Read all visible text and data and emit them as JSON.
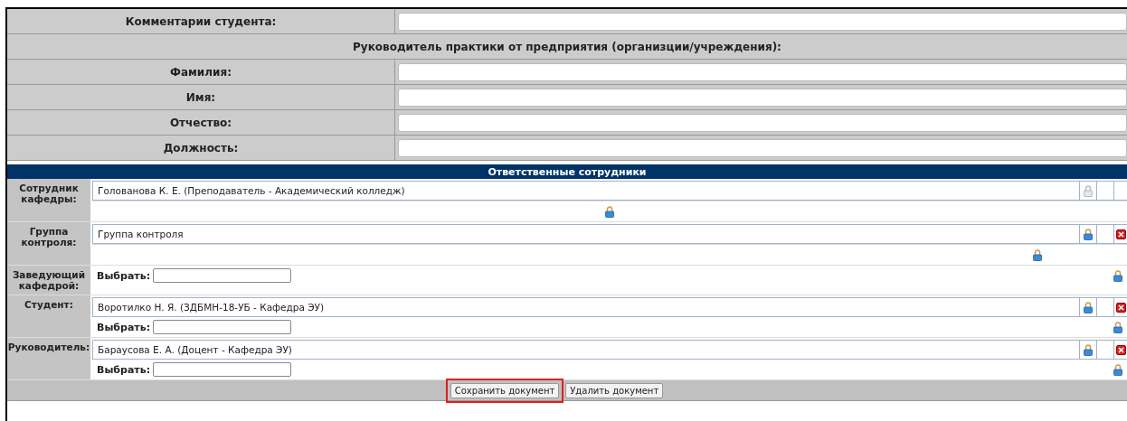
{
  "form_rows": [
    {
      "kind": "field",
      "label": "Комментарии студента:",
      "value": ""
    },
    {
      "kind": "section",
      "label": "Руководитель практики от предприятия (организции/учреждения):"
    },
    {
      "kind": "field",
      "label": "Фамилия:",
      "value": ""
    },
    {
      "kind": "field",
      "label": "Имя:",
      "value": ""
    },
    {
      "kind": "field",
      "label": "Отчество:",
      "value": ""
    },
    {
      "kind": "field",
      "label": "Должность:",
      "value": ""
    }
  ],
  "staff_section": {
    "title": "Ответственные сотрудники",
    "rows": [
      {
        "label": "Сотрудник кафедры:",
        "name": "Голованова К. Е. (Преподаватель - Академический колледж)",
        "lock_disabled": true,
        "deletable": false,
        "extra": {
          "kind": "lock_center"
        }
      },
      {
        "label": "Группа контроля:",
        "name": "Группа контроля",
        "lock_disabled": false,
        "deletable": true,
        "extra": {
          "kind": "lock_offset"
        }
      },
      {
        "label": "Заведующий кафедрой:",
        "extra": {
          "kind": "select",
          "select_label": "Выбрать:"
        }
      },
      {
        "label": "Студент:",
        "name": "Воротилко Н. Я. (ЗДБМН-18-УБ - Кафедра ЭУ)",
        "lock_disabled": false,
        "deletable": true,
        "extra": {
          "kind": "select",
          "select_label": "Выбрать:"
        }
      },
      {
        "label": "Руководитель:",
        "name": "Бараусова Е. А. (Доцент - Кафедра ЭУ)",
        "lock_disabled": false,
        "deletable": true,
        "extra": {
          "kind": "select",
          "select_label": "Выбрать:"
        }
      }
    ]
  },
  "buttons": [
    {
      "label": "Сохранить документ",
      "highlighted": true
    },
    {
      "label": "Удалить документ",
      "highlighted": false
    }
  ]
}
